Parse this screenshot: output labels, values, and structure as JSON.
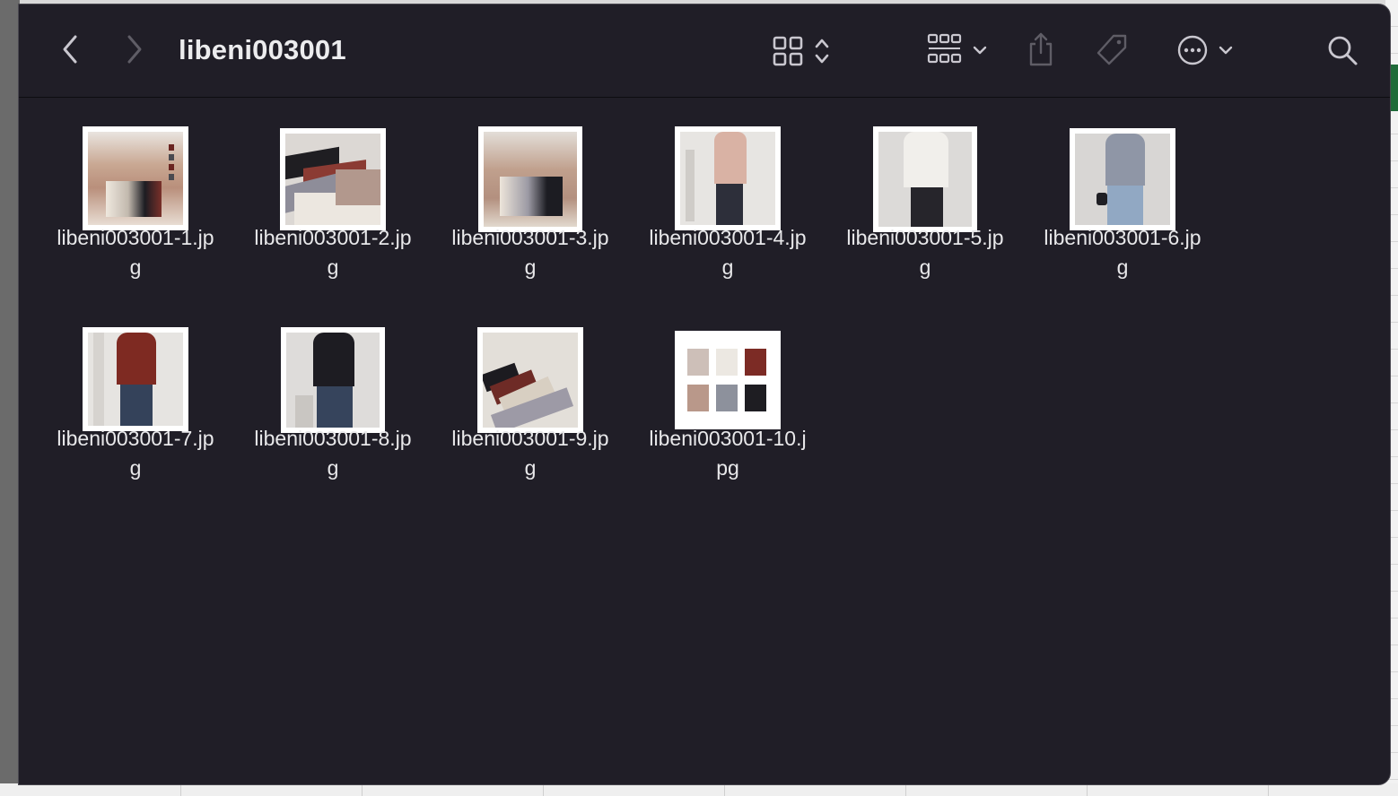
{
  "window": {
    "title": "libeni003001"
  },
  "toolbar": {
    "back_icon": "chevron-left-icon",
    "forward_icon": "chevron-right-icon",
    "view_icon": "grid-view-icon",
    "group_icon": "group-by-icon",
    "share_icon": "share-icon",
    "tag_icon": "tag-icon",
    "more_icon": "ellipsis-circle-icon",
    "search_icon": "search-icon"
  },
  "files": [
    {
      "name": "libeni003001-1.jpg",
      "line1": "libeni003001-1.jp",
      "line2": "g"
    },
    {
      "name": "libeni003001-2.jpg",
      "line1": "libeni003001-2.jp",
      "line2": "g"
    },
    {
      "name": "libeni003001-3.jpg",
      "line1": "libeni003001-3.jp",
      "line2": "g"
    },
    {
      "name": "libeni003001-4.jpg",
      "line1": "libeni003001-4.jp",
      "line2": "g"
    },
    {
      "name": "libeni003001-5.jpg",
      "line1": "libeni003001-5.jp",
      "line2": "g"
    },
    {
      "name": "libeni003001-6.jpg",
      "line1": "libeni003001-6.jp",
      "line2": "g"
    },
    {
      "name": "libeni003001-7.jpg",
      "line1": "libeni003001-7.jp",
      "line2": "g"
    },
    {
      "name": "libeni003001-8.jpg",
      "line1": "libeni003001-8.jp",
      "line2": "g"
    },
    {
      "name": "libeni003001-9.jpg",
      "line1": "libeni003001-9.jp",
      "line2": "g"
    },
    {
      "name": "libeni003001-10.jpg",
      "line1": "libeni003001-10.j",
      "line2": "pg"
    }
  ],
  "colors": {
    "window_bg": "#201e27",
    "text": "#e8e8ea",
    "icon": "#9a98a0"
  }
}
